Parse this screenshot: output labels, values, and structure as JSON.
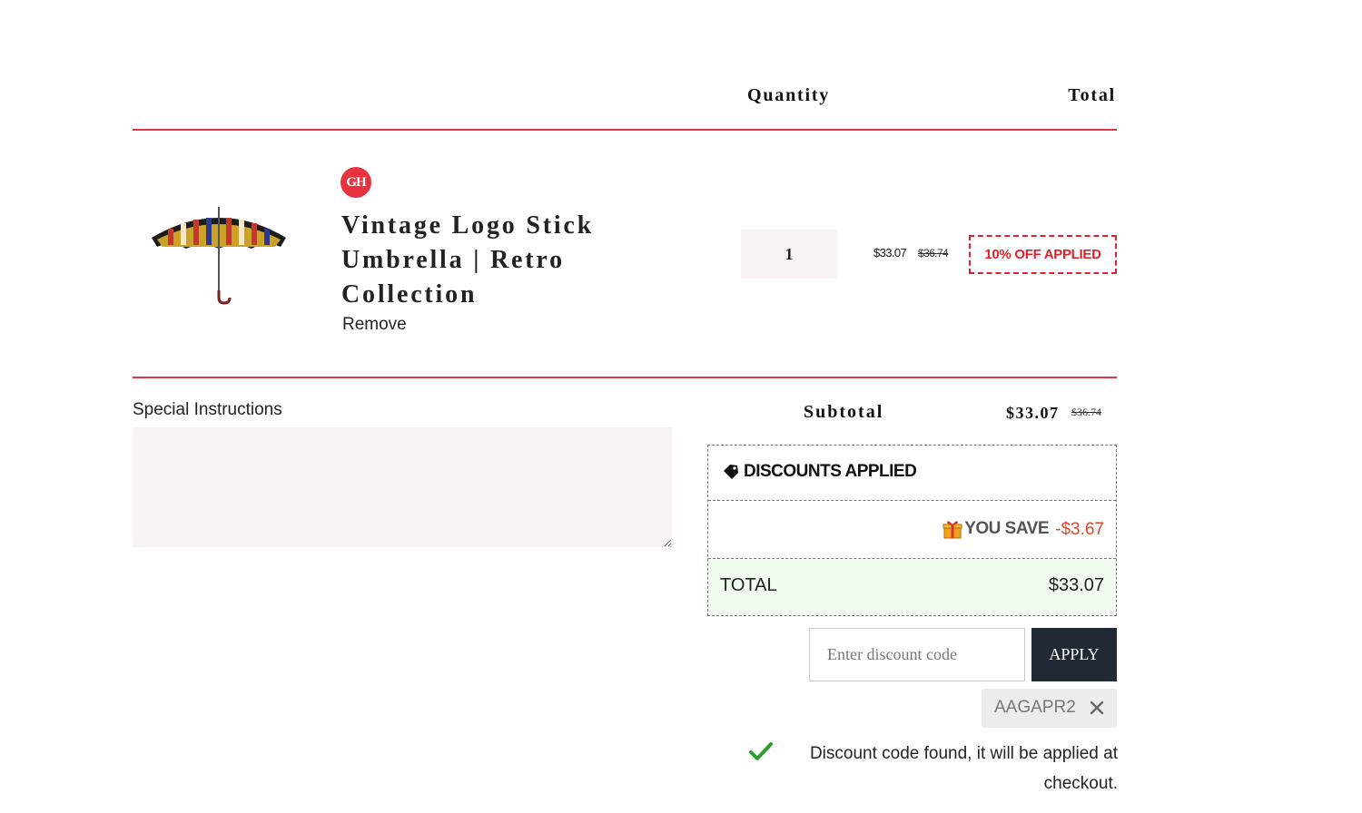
{
  "table_header": {
    "quantity_label": "Quantity",
    "total_label": "Total"
  },
  "line_item": {
    "brand_logo_text": "GH",
    "title": "Vintage Logo Stick Umbrella | Retro Collection",
    "remove_label": "Remove",
    "quantity": "1",
    "price": "$33.07",
    "compare_price": "$36.74",
    "discount_badge": "10% OFF APPLIED"
  },
  "special_instructions": {
    "label": "Special Instructions",
    "value": ""
  },
  "subtotal": {
    "label": "Subtotal",
    "price": "$33.07",
    "compare_price": "$36.74"
  },
  "discounts": {
    "header": "DISCOUNTS APPLIED",
    "you_save_label": "YOU SAVE",
    "you_save_value": "-$3.67",
    "total_label": "TOTAL",
    "total_value": "$33.07"
  },
  "discount_form": {
    "placeholder": "Enter discount code",
    "value": "",
    "apply_label": "APPLY",
    "applied_code": "AAGAPR2",
    "message": "Discount code found, it will be applied at checkout."
  },
  "colors": {
    "accent_red": "#e0363f",
    "apply_button_bg": "#212934",
    "savings_orange": "#e0462a",
    "total_row_bg": "#f2fbef",
    "input_bg": "#f9f3f3",
    "check_green": "#2e9e2e"
  },
  "icons": {
    "tag": "tag-icon",
    "gift": "gift-icon",
    "close": "close-icon",
    "check": "checkmark-icon"
  }
}
